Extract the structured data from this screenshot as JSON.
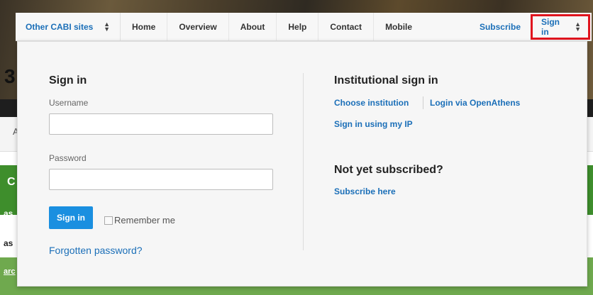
{
  "background": {
    "logo_fragment": "3",
    "menu_fragment": "A",
    "green_fragment": "C",
    "line_fragment_1": "as",
    "line_fragment_2": "as",
    "link_fragment": "arc"
  },
  "nav": {
    "other_sites": "Other CABI sites",
    "items": [
      "Home",
      "Overview",
      "About",
      "Help",
      "Contact",
      "Mobile"
    ],
    "subscribe": "Subscribe",
    "sign_in": "Sign in"
  },
  "signin": {
    "title": "Sign in",
    "username_label": "Username",
    "username_value": "",
    "password_label": "Password",
    "password_value": "",
    "button": "Sign in",
    "remember": "Remember me",
    "forgot": "Forgotten password?"
  },
  "institutional": {
    "title": "Institutional sign in",
    "choose": "Choose institution",
    "openathens": "Login via OpenAthens",
    "ip": "Sign in using my IP"
  },
  "subscribe_section": {
    "title": "Not yet subscribed?",
    "link": "Subscribe here"
  },
  "colors": {
    "accent": "#1b6fb8",
    "button": "#1a8fe0",
    "highlight": "#e0141e"
  }
}
